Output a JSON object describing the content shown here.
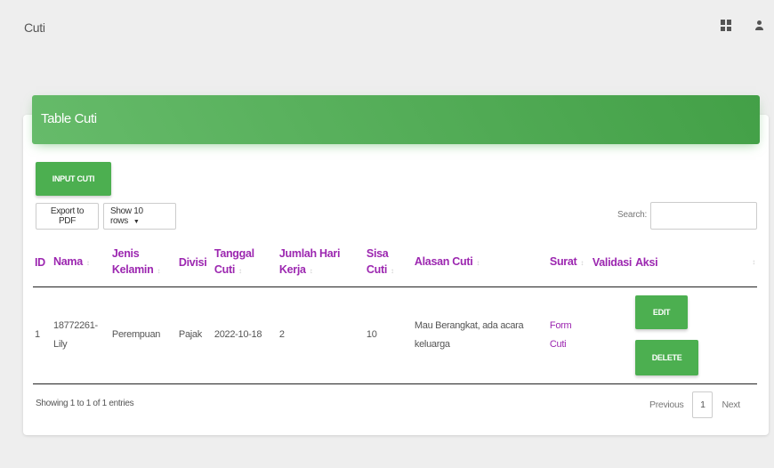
{
  "app": {
    "title": "Cuti"
  },
  "top_icons": [
    "dashboard-icon",
    "person-icon"
  ],
  "card": {
    "title": "Table Cuti",
    "input_button": "INPUT CUTI",
    "export_button": "Export to PDF",
    "rows_button": "Show 10 rows",
    "search_label": "Search:",
    "search_value": ""
  },
  "table": {
    "columns": [
      "ID",
      "Nama",
      "Jenis Kelamin",
      "Divisi",
      "Tanggal Cuti",
      "Jumlah Hari Kerja",
      "Sisa Cuti",
      "Alasan Cuti",
      "Surat",
      "Validasi",
      "Aksi"
    ],
    "rows": [
      {
        "id": "1",
        "nama": "18772261-Lily",
        "jenis_kelamin": "Perempuan",
        "divisi": "Pajak",
        "tanggal_cuti": "2022-10-18",
        "jumlah_hari_kerja": "2",
        "sisa_cuti": "10",
        "alasan_cuti": "Mau Berangkat, ada acara keluarga",
        "surat": "Form Cuti",
        "validasi": "",
        "edit_label": "EDIT",
        "delete_label": "DELETE"
      }
    ]
  },
  "footer": {
    "info": "Showing 1 to 1 of 1 entries",
    "previous": "Previous",
    "current_page": "1",
    "next": "Next"
  },
  "colors": {
    "accent": "#4caf50",
    "header_text": "#9c27b0"
  }
}
